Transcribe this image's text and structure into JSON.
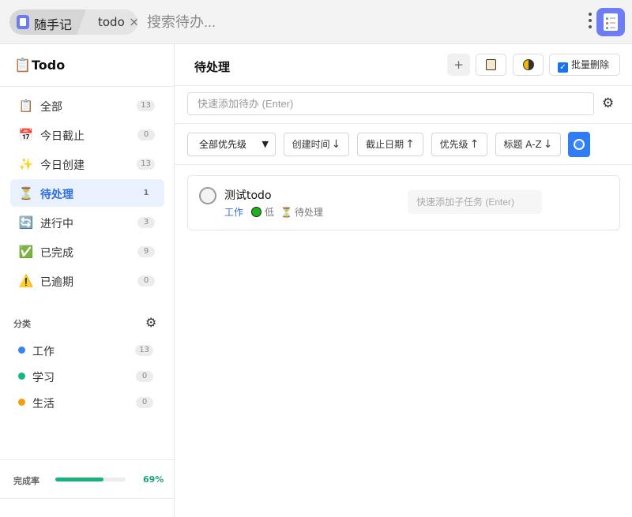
{
  "topbar": {
    "app_name": "随手记",
    "tab_label": "todo",
    "search_placeholder": "搜索待办..."
  },
  "sidebar": {
    "title": "Todo",
    "items": [
      {
        "icon": "clipboard-icon",
        "glyph": "📋",
        "label": "全部",
        "count": "13",
        "active": false
      },
      {
        "icon": "calendar-icon",
        "glyph": "📅",
        "label": "今日截止",
        "count": "0",
        "active": false
      },
      {
        "icon": "sparkle-icon",
        "glyph": "✨",
        "label": "今日创建",
        "count": "13",
        "active": false
      },
      {
        "icon": "hourglass-icon",
        "glyph": "⏳",
        "label": "待处理",
        "count": "1",
        "active": true
      },
      {
        "icon": "refresh-icon",
        "glyph": "🔄",
        "label": "进行中",
        "count": "3",
        "active": false
      },
      {
        "icon": "check-box-icon",
        "glyph": "✅",
        "label": "已完成",
        "count": "9",
        "active": false
      },
      {
        "icon": "warning-icon",
        "glyph": "⚠️",
        "label": "已逾期",
        "count": "0",
        "active": false
      }
    ],
    "categories_title": "分类",
    "categories": [
      {
        "label": "工作",
        "count": "13",
        "color": "#3b82f6"
      },
      {
        "label": "学习",
        "count": "0",
        "color": "#10b981"
      },
      {
        "label": "生活",
        "count": "0",
        "color": "#f59e0b"
      }
    ],
    "progress": {
      "label": "完成率",
      "value_text": "69%",
      "fraction": 0.69
    }
  },
  "main": {
    "title": "待处理",
    "toolbar": {
      "add_label": "+",
      "batch_delete_label": "批量删除"
    },
    "quick_add_placeholder": "快速添加待办 (Enter)",
    "filters": {
      "priority_select": "全部优先级",
      "sort_created": "创建时间",
      "sort_created_arrow": "↓",
      "sort_due": "截止日期",
      "sort_due_arrow": "↑",
      "sort_priority": "优先级",
      "sort_priority_arrow": "↑",
      "sort_title": "标题 A-Z",
      "sort_title_arrow": "↓"
    },
    "todos": [
      {
        "title": "测试todo",
        "category": "工作",
        "priority": "低",
        "status": "待处理",
        "subtask_placeholder": "快速添加子任务 (Enter)"
      }
    ]
  },
  "colors": {
    "accent": "#2f6fe0",
    "progress": "#19b37a",
    "priority_low": "#1db31d"
  }
}
